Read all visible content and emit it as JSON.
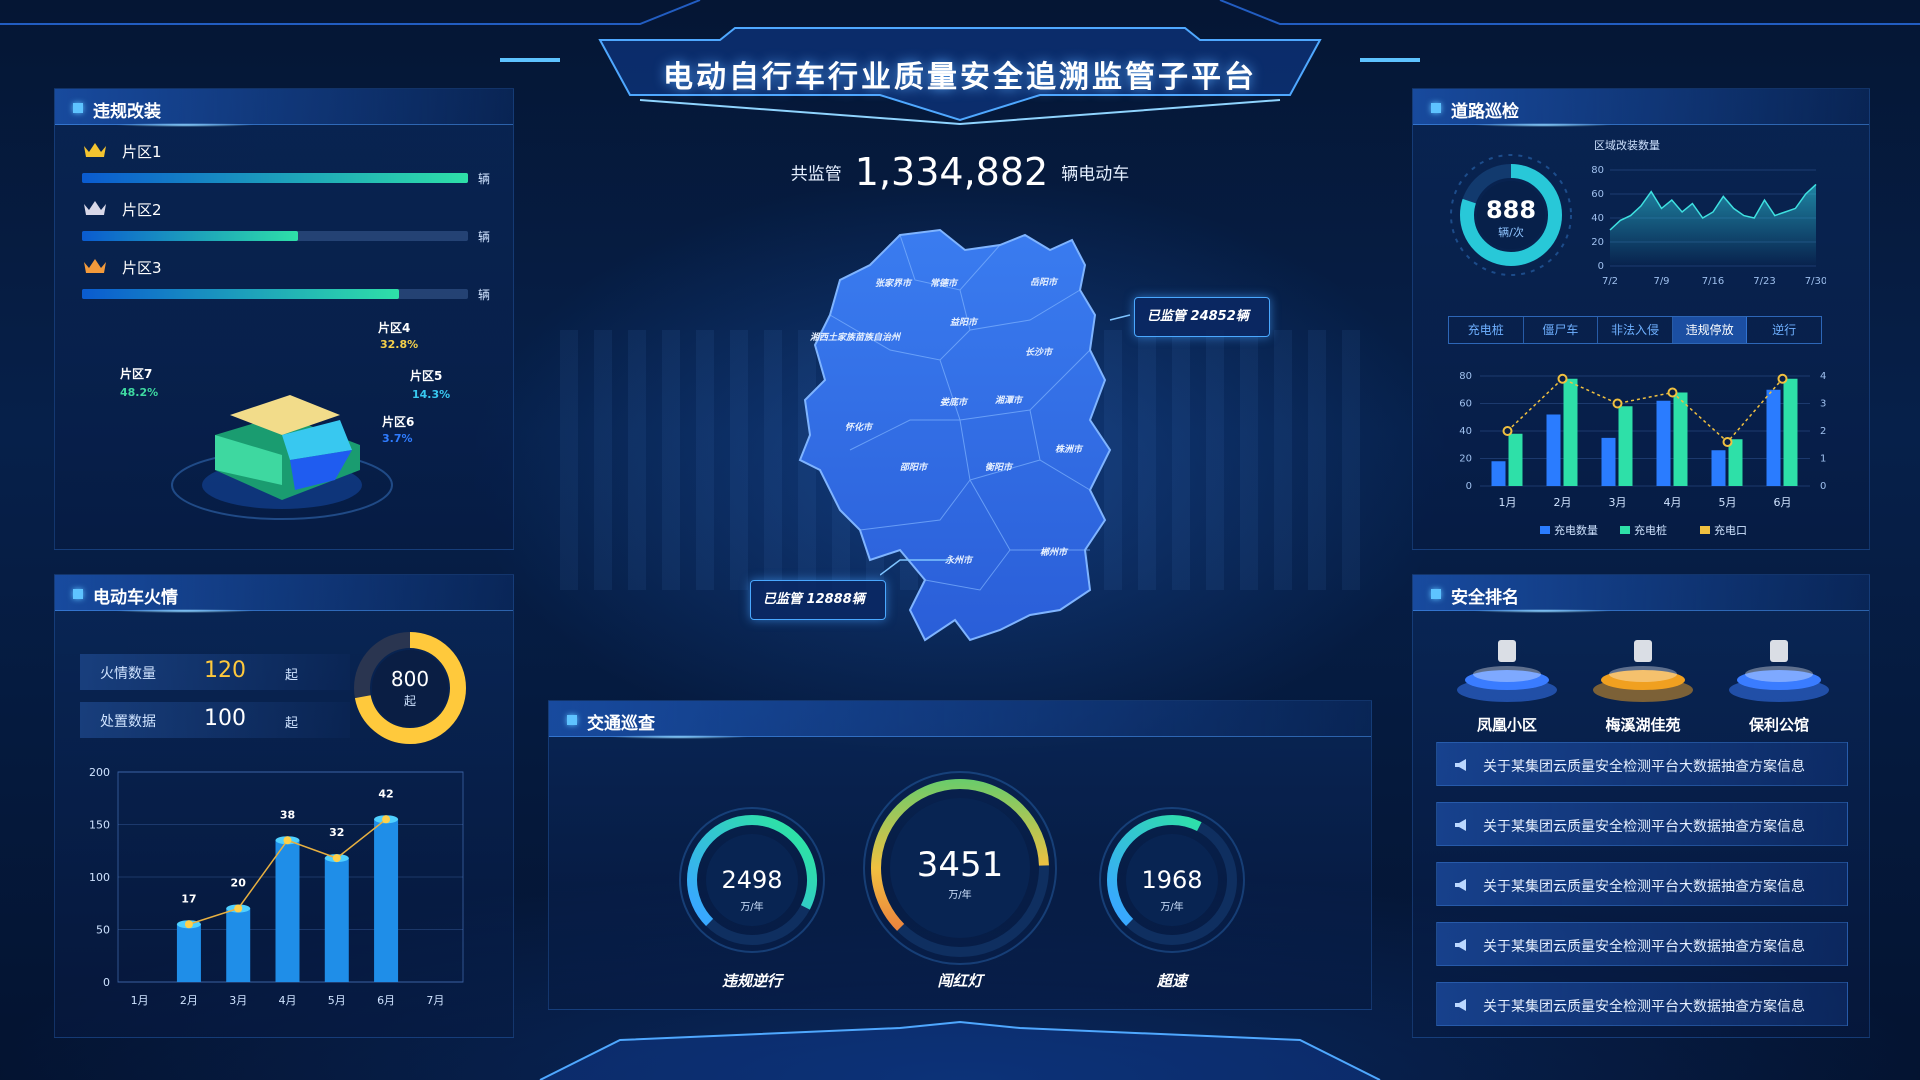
{
  "title": "电动自行车行业质量安全追溯监管子平台",
  "summary": {
    "prefix": "共监管",
    "count": "1,334,882",
    "suffix": "辆电动车"
  },
  "violation": {
    "title": "违规改装",
    "zones": [
      {
        "label": "片区1",
        "unit": "辆",
        "level": 1.0,
        "crown": "#f4c430"
      },
      {
        "label": "片区2",
        "unit": "辆",
        "level": 0.56,
        "crown": "#d8d8e8"
      },
      {
        "label": "片区3",
        "unit": "辆",
        "level": 0.82,
        "crown": "#f39a3b"
      }
    ],
    "pie": [
      {
        "label": "片区7",
        "pct": "48.2%",
        "color": "#3ed8a0",
        "pctColor": "#3ed8a0"
      },
      {
        "label": "片区4",
        "pct": "32.8%",
        "color": "#f2dc8a",
        "pctColor": "#f5d04a"
      },
      {
        "label": "片区5",
        "pct": "14.3%",
        "color": "#38c8f0",
        "pctColor": "#38c8f0"
      },
      {
        "label": "片区6",
        "pct": "3.7%",
        "color": "#1f5cf0",
        "pctColor": "#2f7cff"
      }
    ]
  },
  "fire": {
    "title": "电动车火情",
    "rows": [
      {
        "label": "火情数量",
        "value": "120",
        "unit": "起",
        "color": "#ffc93c"
      },
      {
        "label": "处置数据",
        "value": "100",
        "unit": "起",
        "color": "#ffffff"
      }
    ],
    "ring": {
      "value": "800",
      "unit": "起",
      "fraction": 0.72
    },
    "chart_data": {
      "type": "bar",
      "categories": [
        "1月",
        "2月",
        "3月",
        "4月",
        "5月",
        "6月",
        "7月"
      ],
      "values": [
        null,
        55,
        70,
        135,
        118,
        155,
        null
      ],
      "labels": [
        null,
        "17",
        "20",
        "38",
        "32",
        "42",
        null
      ],
      "ylim": [
        0,
        200
      ],
      "yticks": [
        "0",
        "50",
        "100",
        "150",
        "200"
      ]
    }
  },
  "map": {
    "cities": [
      "张家界市",
      "常德市",
      "岳阳市",
      "湘西土家族苗族自治州",
      "益阳市",
      "长沙市",
      "怀化市",
      "娄底市",
      "湘潭市",
      "株洲市",
      "邵阳市",
      "衡阳市",
      "永州市",
      "郴州市"
    ],
    "callout1": "已监管  24852辆",
    "callout2": "已监管  12888辆"
  },
  "traffic": {
    "title": "交通巡查",
    "gauges": [
      {
        "value": "2498",
        "unit": "万/年",
        "label": "违规逆行",
        "fraction": 0.7
      },
      {
        "value": "3451",
        "unit": "万/年",
        "label": "闯红灯",
        "fraction": 0.62
      },
      {
        "value": "1968",
        "unit": "万/年",
        "label": "超速",
        "fraction": 0.45
      }
    ]
  },
  "road": {
    "title": "道路巡检",
    "ring": {
      "value": "888",
      "unit": "辆/次",
      "fraction": 0.8
    },
    "area_title": "区域改装数量",
    "area_chart": {
      "type": "area",
      "x": [
        "7/2",
        "7/9",
        "7/16",
        "7/23",
        "7/30"
      ],
      "yticks": [
        "0",
        "20",
        "40",
        "60",
        "80"
      ],
      "ylim": [
        0,
        80
      ],
      "values": [
        30,
        38,
        42,
        50,
        62,
        48,
        55,
        45,
        52,
        40,
        45,
        58,
        48,
        42,
        40,
        55,
        42,
        45,
        48,
        60,
        68
      ]
    },
    "tabs": [
      "充电桩",
      "僵尸车",
      "非法入侵",
      "违规停放",
      "逆行"
    ],
    "active_tab": 3,
    "combo_chart": {
      "type": "bar",
      "categories": [
        "1月",
        "2月",
        "3月",
        "4月",
        "5月",
        "6月"
      ],
      "series": [
        {
          "name": "充电数量",
          "values": [
            18,
            52,
            35,
            62,
            26,
            70
          ],
          "color": "#2a7cff"
        },
        {
          "name": "充电桩",
          "values": [
            38,
            78,
            58,
            68,
            34,
            78
          ],
          "color": "#2ee0a8"
        },
        {
          "name": "充电口",
          "values": [
            2,
            3.9,
            3,
            3.4,
            1.6,
            3.9
          ],
          "color": "#f0c040"
        }
      ],
      "yticks_left": [
        "0",
        "20",
        "40",
        "60",
        "80"
      ],
      "yticks_right": [
        "0",
        "1",
        "2",
        "3",
        "4"
      ]
    }
  },
  "safety": {
    "title": "安全排名",
    "podium": [
      {
        "label": "凤凰小区",
        "color": "#3a7cff"
      },
      {
        "label": "梅溪湖佳苑",
        "color": "#f0a020"
      },
      {
        "label": "保利公馆",
        "color": "#3a7cff"
      }
    ],
    "items": [
      "关于某集团云质量安全检测平台大数据抽查方案信息",
      "关于某集团云质量安全检测平台大数据抽查方案信息",
      "关于某集团云质量安全检测平台大数据抽查方案信息",
      "关于某集团云质量安全检测平台大数据抽查方案信息",
      "关于某集团云质量安全检测平台大数据抽查方案信息"
    ]
  }
}
